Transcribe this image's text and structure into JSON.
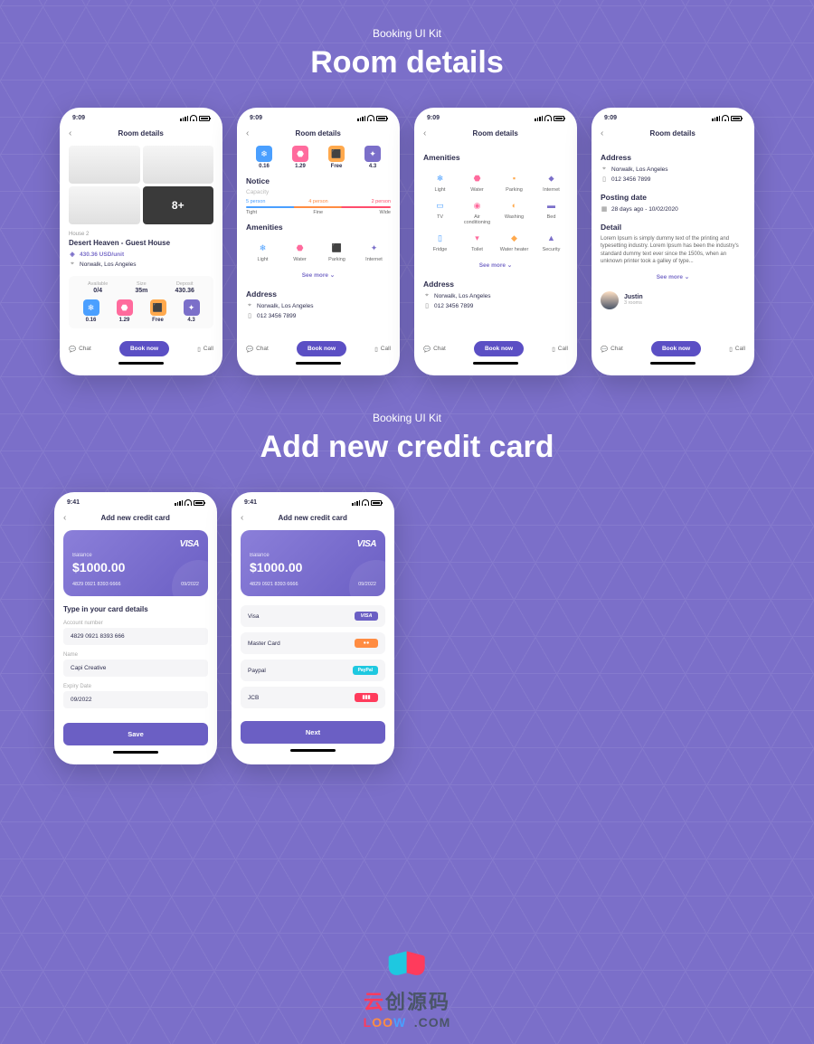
{
  "section1": {
    "kicker": "Booking UI Kit",
    "title": "Room details"
  },
  "section2": {
    "kicker": "Booking UI Kit",
    "title": "Add new credit card"
  },
  "status_time": "9:09",
  "status_time2": "9:41",
  "header_title": "Room details",
  "header_title2": "Add new credit card",
  "gallery_more": "8+",
  "room": {
    "kicker_label": "House",
    "kicker_num": "2",
    "name": "Desert Heaven - Guest House",
    "price": "430.36 USD/unit",
    "location": "Norwalk, Los Angeles"
  },
  "stats": [
    {
      "label": "Available",
      "value": "0/4"
    },
    {
      "label": "Size",
      "value": "35m"
    },
    {
      "label": "Deposit",
      "value": "430.36"
    }
  ],
  "features": [
    {
      "value": "0.16",
      "color": "blue",
      "glyph": "❄"
    },
    {
      "value": "1.29",
      "color": "pink",
      "glyph": "⬣"
    },
    {
      "value": "Free",
      "color": "orange",
      "glyph": "⬛"
    },
    {
      "value": "4.3",
      "color": "purple",
      "glyph": "✦"
    }
  ],
  "notice": {
    "title": "Notice",
    "capacity": "Capacity",
    "levels": [
      "5 person",
      "4 person",
      "2 person"
    ],
    "labels": [
      "Tight",
      "Fine",
      "Wide"
    ]
  },
  "amenities_title": "Amenities",
  "amenities1": [
    {
      "label": "Light",
      "glyph": "❄",
      "color": "#4a9fff"
    },
    {
      "label": "Water",
      "glyph": "⬣",
      "color": "#ff6b9d"
    },
    {
      "label": "Parking",
      "glyph": "⬛",
      "color": "#ffa94d"
    },
    {
      "label": "Internet",
      "glyph": "✦",
      "color": "#7b6fc9"
    }
  ],
  "amenities2": [
    {
      "label": "Light",
      "glyph": "❄",
      "color": "#4a9fff"
    },
    {
      "label": "Water",
      "glyph": "⬣",
      "color": "#ff6b9d"
    },
    {
      "label": "Parking",
      "glyph": "▪",
      "color": "#ffa94d"
    },
    {
      "label": "Internet",
      "glyph": "⬥",
      "color": "#7b6fc9"
    },
    {
      "label": "TV",
      "glyph": "▭",
      "color": "#4a9fff"
    },
    {
      "label": "Air conditioning",
      "glyph": "◉",
      "color": "#ff6b9d"
    },
    {
      "label": "Washing",
      "glyph": "◐",
      "color": "#ffa94d"
    },
    {
      "label": "Bed",
      "glyph": "▬",
      "color": "#7b6fc9"
    },
    {
      "label": "Fridge",
      "glyph": "▯",
      "color": "#4a9fff"
    },
    {
      "label": "Toilet",
      "glyph": "▾",
      "color": "#ff6b9d"
    },
    {
      "label": "Water heater",
      "glyph": "◆",
      "color": "#ffa94d"
    },
    {
      "label": "Security",
      "glyph": "▲",
      "color": "#7b6fc9"
    }
  ],
  "see_more": "See more",
  "address": {
    "title": "Address",
    "location": "Norwalk, Los Angeles",
    "phone": "012 3456 7899"
  },
  "posting": {
    "title": "Posting date",
    "value": "28 days ago - 10/02/2020"
  },
  "detail": {
    "title": "Detail",
    "text": "Lorem Ipsum is simply dummy text of the printing and typesetting industry. Lorem Ipsum has been the industry's standard dummy text ever since the 1500s, when an unknown printer took a galley of type..."
  },
  "poster": {
    "name": "Justin",
    "sub": "3 rooms"
  },
  "bottom": {
    "chat": "Chat",
    "book": "Book now",
    "call": "Call"
  },
  "card": {
    "brand": "VISA",
    "balance_label": "Balance",
    "balance": "$1000.00",
    "number": "4829 0921 8393 6666",
    "expiry": "09/2022"
  },
  "form": {
    "title": "Type in your card details",
    "account_label": "Account number",
    "account_value": "4829 0921 8393 666",
    "name_label": "Name",
    "name_value": "Capi Creative",
    "expiry_label": "Expiry Date",
    "expiry_value": "09/2022",
    "save": "Save",
    "next": "Next"
  },
  "pay_options": [
    {
      "label": "Visa",
      "badge": "VISA",
      "cls": "visa-b"
    },
    {
      "label": "Master Card",
      "badge": "●●",
      "cls": "mc"
    },
    {
      "label": "Paypal",
      "badge": "PayPal",
      "cls": "pp"
    },
    {
      "label": "JCB",
      "badge": "▮▮▮",
      "cls": "jcb"
    }
  ],
  "watermark": {
    "cn": "云创源码",
    "url": "LOOWP.COM"
  }
}
